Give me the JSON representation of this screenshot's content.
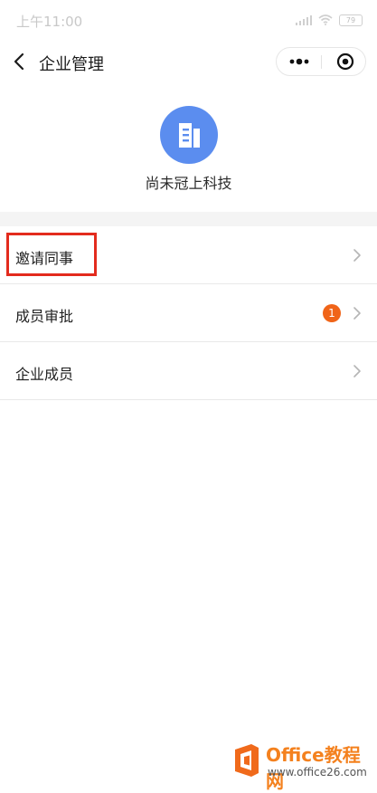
{
  "status_bar": {
    "time": "上午11:00",
    "battery": "79"
  },
  "nav": {
    "title": "企业管理"
  },
  "company": {
    "name": "尚未冠上科技"
  },
  "menu": {
    "items": [
      {
        "label": "邀请同事"
      },
      {
        "label": "成员审批",
        "badge": "1"
      },
      {
        "label": "企业成员"
      }
    ]
  },
  "watermark": {
    "title": "Office教程网",
    "url": "www.office26.com"
  },
  "colors": {
    "accent": "#5b8def",
    "badge": "#f06418",
    "highlight": "#e32b1d",
    "watermark": "#f4811e"
  },
  "icons": [
    "back-arrow-icon",
    "more-dots-icon",
    "close-target-icon",
    "building-icon",
    "chevron-right-icon"
  ]
}
